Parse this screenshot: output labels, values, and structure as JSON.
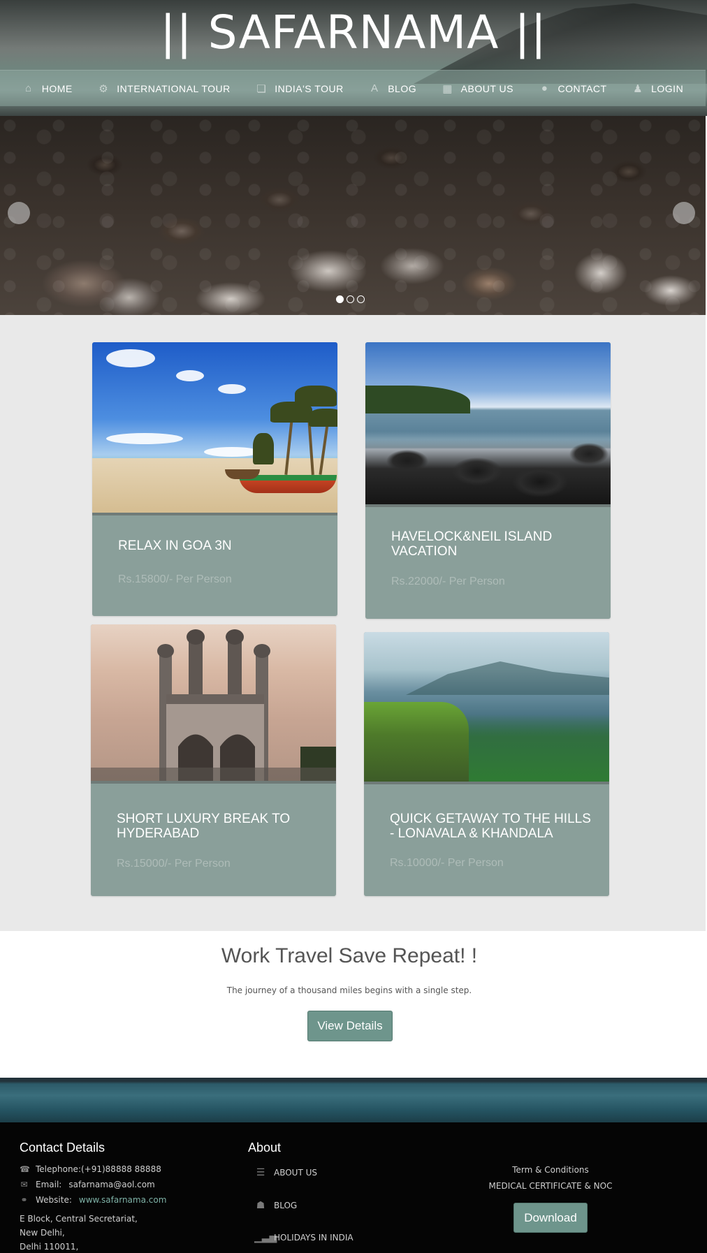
{
  "site": {
    "logo": "|| SAFARNAMA ||"
  },
  "nav": [
    {
      "label": "HOME",
      "icon": "⌂"
    },
    {
      "label": "INTERNATIONAL TOUR",
      "icon": "⚙"
    },
    {
      "label": "INDIA'S TOUR",
      "icon": "❏"
    },
    {
      "label": "BLOG",
      "icon": "A"
    },
    {
      "label": "ABOUT US",
      "icon": "▦"
    },
    {
      "label": "CONTACT",
      "icon": "●"
    },
    {
      "label": "LOGIN",
      "icon": "♟"
    }
  ],
  "slider": {
    "prev_icon": "",
    "next_icon": "",
    "dots": [
      "",
      "",
      ""
    ],
    "active_dot": 0
  },
  "tours": [
    {
      "title": "RELAX IN GOA 3N",
      "price": "Rs.15800/- Per Person"
    },
    {
      "title": "HAVELOCK&NEIL ISLAND VACATION",
      "price": "Rs.22000/- Per Person"
    },
    {
      "title": "SHORT LUXURY BREAK TO HYDERABAD",
      "price": "Rs.15000/- Per Person"
    },
    {
      "title": "QUICK GETAWAY TO THE HILLS - LONAVALA & KHANDALA",
      "price": "Rs.10000/- Per Person"
    }
  ],
  "cta": {
    "title": "Work Travel Save Repeat! !",
    "subtitle": "The journey of a thousand miles begins with a single step.",
    "button": "View Details"
  },
  "footer": {
    "contact": {
      "heading": "Contact Details",
      "telephone": "Telephone:(+91)88888 88888",
      "email_label": "Email:",
      "email": "safarnama@aol.com",
      "website_label": "Website:",
      "website": "www.safarnama.com",
      "address": [
        "E Block, Central Secretariat,",
        "New Delhi,",
        "Delhi 110011,"
      ]
    },
    "about": {
      "heading": "About",
      "items": [
        {
          "label": "ABOUT US",
          "icon": "☰"
        },
        {
          "label": "BLOG",
          "icon": "☗"
        },
        {
          "label": "HOLIDAYS IN INDIA",
          "icon": "▁▃▅"
        }
      ]
    },
    "right": {
      "terms": "Term & Conditions",
      "certificate": "MEDICAL CERTIFICATE & NOC",
      "download": "Download"
    }
  },
  "colors": {
    "accent": "#6e958c",
    "card_bg": "#8a9f9a",
    "section_bg": "#e9e9e9",
    "footer_bg": "#050505"
  }
}
